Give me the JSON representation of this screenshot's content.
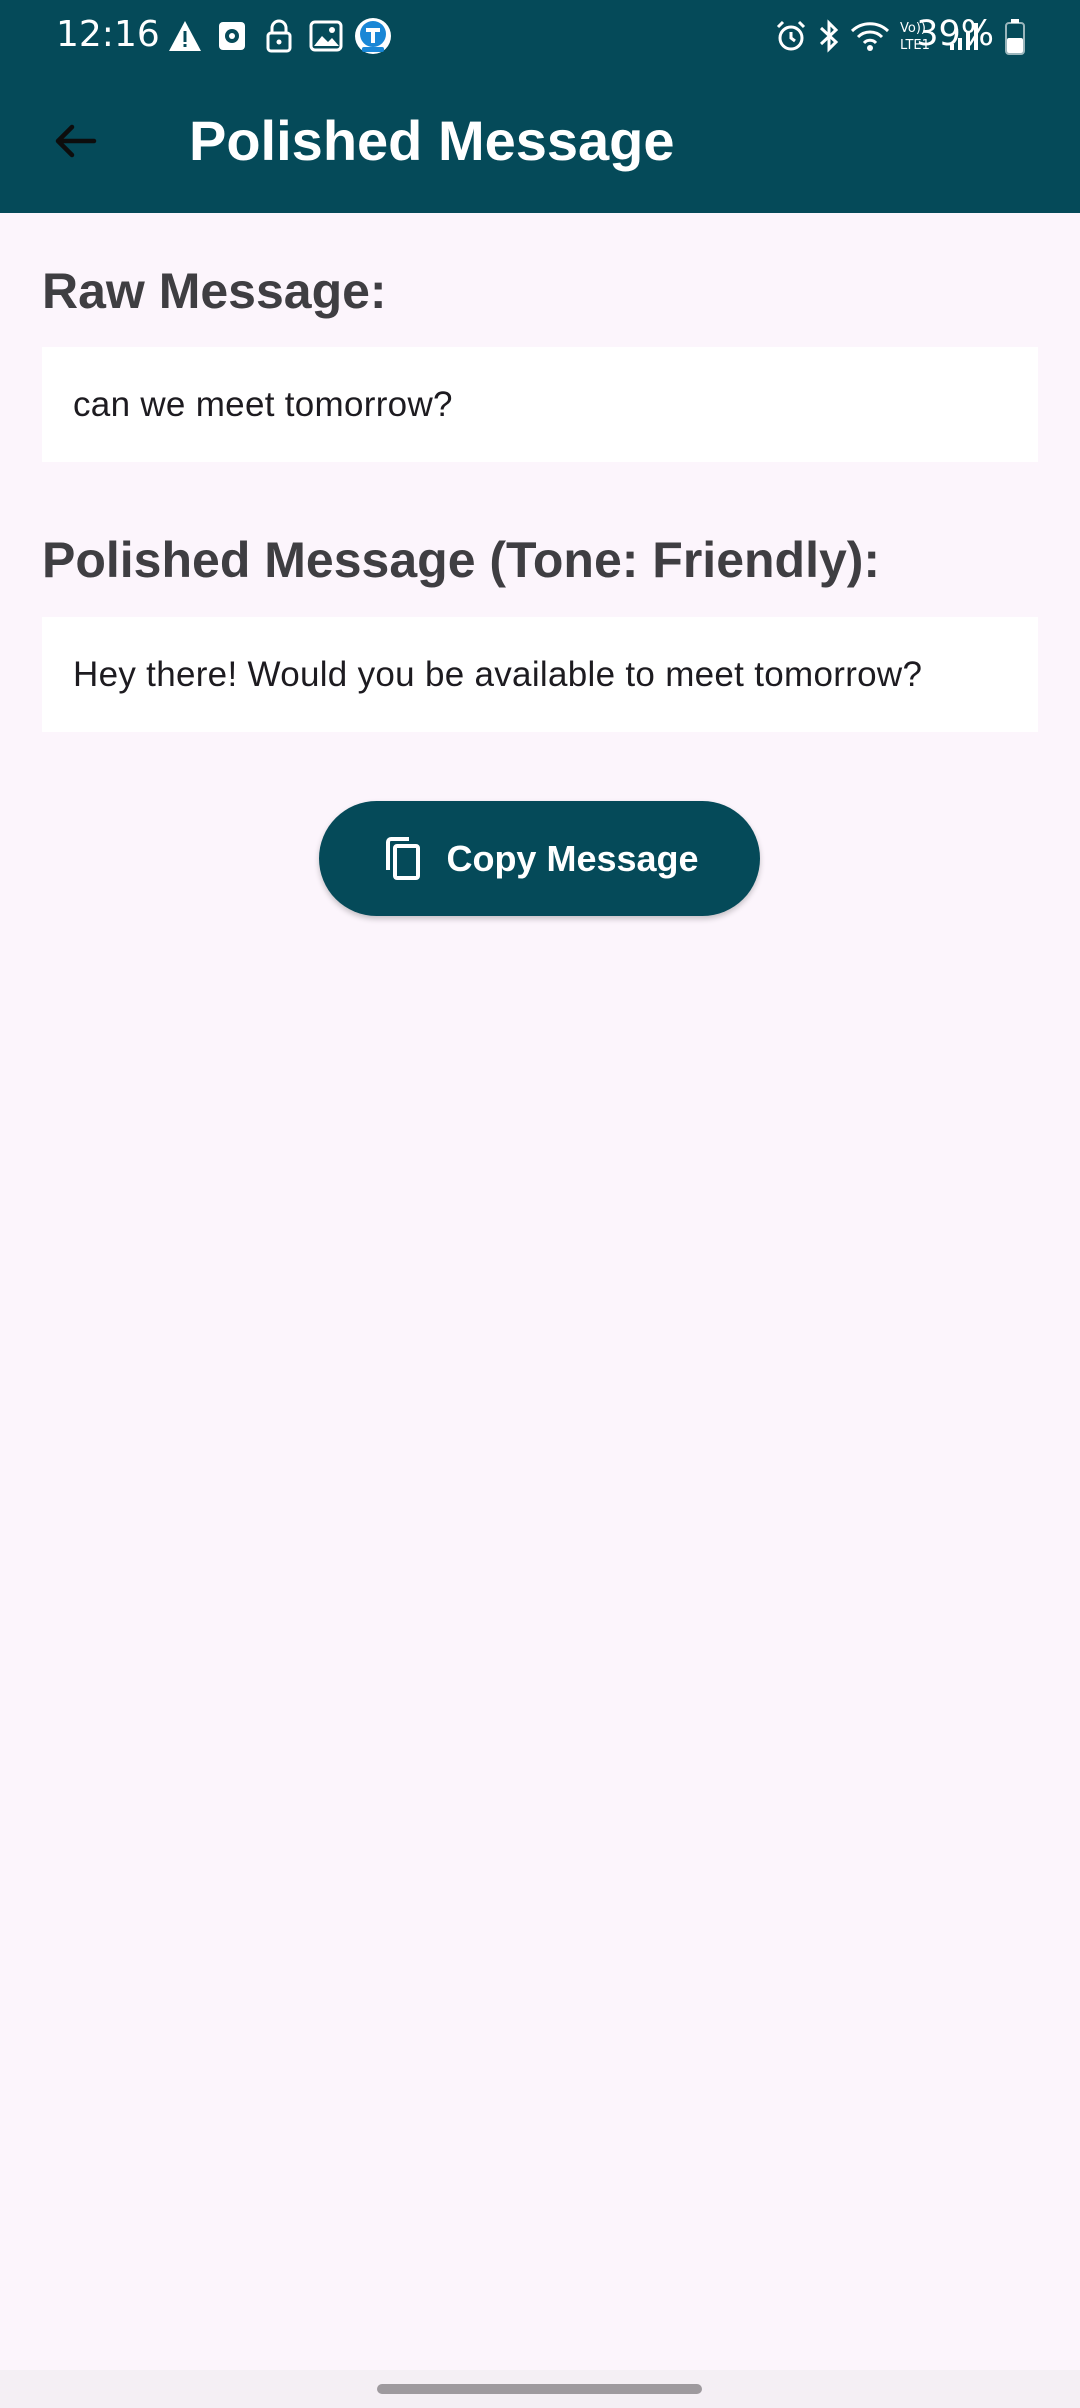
{
  "status_bar": {
    "time": "12:16",
    "battery_percent": "39%",
    "left_icons": [
      "warning-icon",
      "media-icon",
      "lock-icon",
      "gallery-icon",
      "app-notification-icon"
    ],
    "right_icons": [
      "alarm-icon",
      "bluetooth-icon",
      "wifi-icon",
      "volte-icon",
      "signal-icon",
      "battery-icon"
    ],
    "volte_label": "Vo)) LTE1"
  },
  "app_bar": {
    "title": "Polished Message",
    "back_icon": "arrow-back-icon"
  },
  "raw": {
    "label": "Raw Message:",
    "text": "can we meet tomorrow?"
  },
  "polished": {
    "label": "Polished Message (Tone: Friendly):",
    "text": "Hey there! Would you be available to meet tomorrow?"
  },
  "copy_button": {
    "label": "Copy Message",
    "icon": "copy-icon"
  },
  "colors": {
    "primary": "#054a59",
    "background": "#fcf5fc",
    "label_text": "#3f3e42",
    "body_text": "#1d1b20"
  }
}
